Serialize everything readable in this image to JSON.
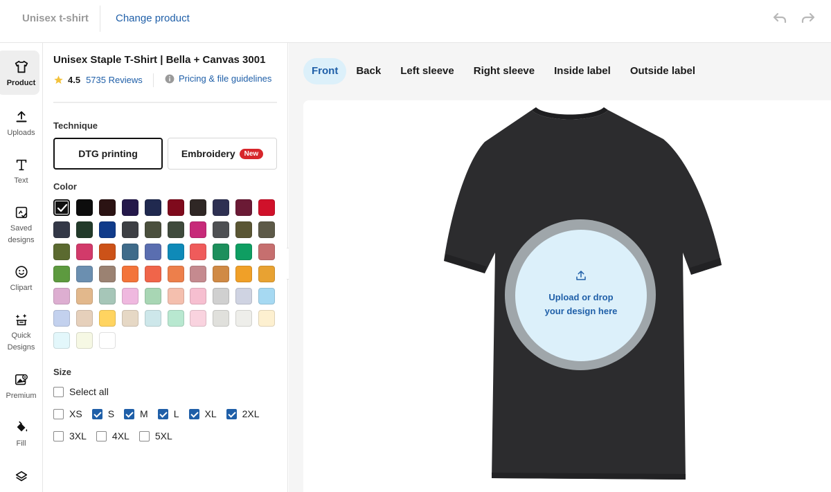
{
  "topbar": {
    "product_short": "Unisex t-shirt",
    "change_product": "Change product"
  },
  "rail": [
    {
      "label": "Product",
      "icon": "shirt-icon",
      "active": true
    },
    {
      "label": "Uploads",
      "icon": "upload-icon"
    },
    {
      "label": "Text",
      "icon": "text-icon"
    },
    {
      "label": "Saved designs",
      "icon": "saved-designs-icon"
    },
    {
      "label": "Clipart",
      "icon": "smiley-icon"
    },
    {
      "label": "Quick Designs",
      "icon": "magic-wand-icon"
    },
    {
      "label": "Premium",
      "icon": "premium-image-icon"
    },
    {
      "label": "Fill",
      "icon": "paint-bucket-icon"
    },
    {
      "label": "",
      "icon": "layers-icon"
    }
  ],
  "panel": {
    "title": "Unisex Staple T-Shirt | Bella + Canvas 3001",
    "rating": "4.5",
    "reviews": "5735 Reviews",
    "guidelines": "Pricing & file guidelines",
    "technique_label": "Technique",
    "technique_options": [
      "DTG printing",
      "Embroidery"
    ],
    "technique_selected": "DTG printing",
    "new_badge": "New",
    "color_label": "Color",
    "colors": [
      "#111111",
      "#0d0d0d",
      "#2b1313",
      "#24184a",
      "#20294f",
      "#7f0a1c",
      "#2f2725",
      "#2e3052",
      "#6b1a35",
      "#d0112a",
      "#333847",
      "#223a2a",
      "#103b8a",
      "#3d3f44",
      "#4a4f3d",
      "#3f4a3c",
      "#c72a79",
      "#4e5053",
      "#5a5634",
      "#5d5a48",
      "#5b6a30",
      "#d23a6a",
      "#cc5218",
      "#3f6b8a",
      "#5a6eb0",
      "#0f8ab8",
      "#ef5b5b",
      "#1c8f5c",
      "#0f9e62",
      "#c66f6f",
      "#5d9a3f",
      "#6b8fb0",
      "#9b8272",
      "#f3743a",
      "#f0654a",
      "#ed7f4b",
      "#c58a8f",
      "#d08a45",
      "#f0a028",
      "#e8a232",
      "#ddaed1",
      "#e2b88c",
      "#a6c6b8",
      "#efb8df",
      "#a8d6b4",
      "#f4bfae",
      "#f6bfd0",
      "#d0d0d0",
      "#cfd3e2",
      "#a6d9f2",
      "#c3d1ee",
      "#e6d0bb",
      "#ffd460",
      "#e6d8c5",
      "#cde7ea",
      "#b8e8d0",
      "#f9d3df",
      "#e0e0dc",
      "#eeeeea",
      "#fdf0d0",
      "#e3f7fb",
      "#f6f8e4",
      "#ffffff"
    ],
    "selected_color_index": 0,
    "size_label": "Size",
    "select_all": "Select all",
    "sizes": [
      {
        "label": "XS",
        "checked": false
      },
      {
        "label": "S",
        "checked": true
      },
      {
        "label": "M",
        "checked": true
      },
      {
        "label": "L",
        "checked": true
      },
      {
        "label": "XL",
        "checked": true
      },
      {
        "label": "2XL",
        "checked": true
      },
      {
        "label": "3XL",
        "checked": false
      },
      {
        "label": "4XL",
        "checked": false
      },
      {
        "label": "5XL",
        "checked": false
      }
    ]
  },
  "main": {
    "tabs": [
      "Front",
      "Back",
      "Left sleeve",
      "Right sleeve",
      "Inside label",
      "Outside label"
    ],
    "active_tab": "Front",
    "drop_line1": "Upload or drop",
    "drop_line2": "your design here",
    "shirt_color": "#2c2c2e"
  },
  "colors": {
    "accent": "#1f5fa8",
    "accent_light": "#dcf0fa",
    "badge_red": "#d7262b"
  }
}
